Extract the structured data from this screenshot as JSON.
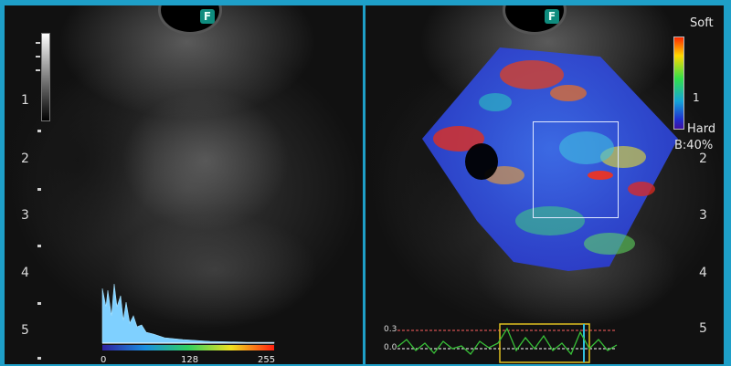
{
  "left": {
    "marker": "F",
    "depth_scale": [
      "1",
      "2",
      "3",
      "4",
      "5"
    ],
    "histogram": {
      "scale_labels": [
        "0",
        "128",
        "255"
      ]
    }
  },
  "right": {
    "marker": "F",
    "depth_scale": [
      "2",
      "3",
      "4",
      "5"
    ],
    "colorbar": {
      "top_label": "Soft",
      "bottom_label": "Hard",
      "mark": "1",
      "percent": "B:40%"
    },
    "strain_graph": {
      "labels": [
        "0.3",
        "0.0"
      ]
    }
  },
  "colors": {
    "frame": "#1e9fc8",
    "background": "#050505",
    "text": "#dcdcdc",
    "graph_line": "#38c038",
    "graph_box": "#e0c020"
  },
  "icons": [
    "grayscale-bar-icon",
    "color-scale-icon",
    "histogram-icon",
    "roi-box-icon",
    "strain-graph-icon"
  ]
}
